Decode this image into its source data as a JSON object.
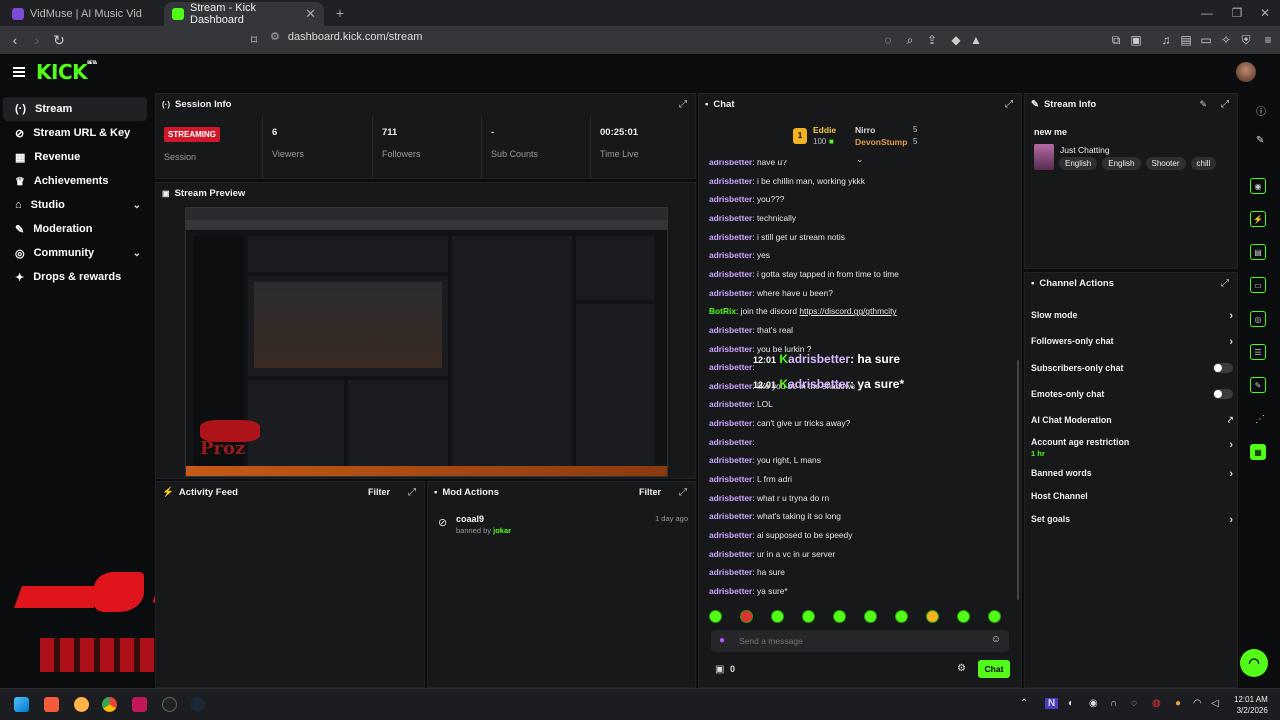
{
  "browser": {
    "tabs": [
      {
        "title": "VidMuse | AI Music Video Agent for",
        "active": false
      },
      {
        "title": "Stream - Kick Dashboard",
        "active": true
      }
    ],
    "url": "dashboard.kick.com/stream"
  },
  "site": {
    "logo": "KICK",
    "logo_badge": "BETA"
  },
  "sidebar": {
    "items": [
      {
        "label": "Stream",
        "icon": "broadcast-icon"
      },
      {
        "label": "Stream URL & Key",
        "icon": "link-icon"
      },
      {
        "label": "Revenue",
        "icon": "revenue-icon"
      },
      {
        "label": "Achievements",
        "icon": "trophy-icon"
      },
      {
        "label": "Studio",
        "icon": "studio-icon"
      },
      {
        "label": "Moderation",
        "icon": "wrench-icon"
      },
      {
        "label": "Community",
        "icon": "community-icon"
      },
      {
        "label": "Drops & rewards",
        "icon": "gift-icon"
      }
    ]
  },
  "session_info": {
    "title": "Session Info",
    "status_badge": "STREAMING",
    "session_label": "Session",
    "stats": [
      {
        "value": "6",
        "label": "Viewers"
      },
      {
        "value": "711",
        "label": "Followers"
      },
      {
        "value": "-",
        "label": "Sub Counts"
      },
      {
        "value": "00:25:01",
        "label": "Time Live"
      }
    ]
  },
  "stream_preview": {
    "title": "Stream Preview",
    "overlay_text": "Proz"
  },
  "activity_feed": {
    "title": "Activity Feed",
    "filter_label": "Filter"
  },
  "mod_actions": {
    "title": "Mod Actions",
    "filter_label": "Filter",
    "items": [
      {
        "user": "coaal9",
        "action_prefix": "banned by",
        "moderator": "jokar",
        "time": "1 day ago"
      }
    ]
  },
  "chat": {
    "title": "Chat",
    "leaderboard": [
      {
        "rank": "1",
        "name": "Eddie",
        "points": "100"
      },
      {
        "name": "Nirro",
        "points": "5"
      },
      {
        "name": "DevonStump",
        "points": "5"
      }
    ],
    "messages": [
      {
        "user": "adrisbetter",
        "text": "have u?"
      },
      {
        "user": "adrisbetter",
        "text": "i be chillin man, working ykkk"
      },
      {
        "user": "adrisbetter",
        "text": "you???"
      },
      {
        "user": "adrisbetter",
        "text": "technically"
      },
      {
        "user": "adrisbetter",
        "text": "i still get ur stream notis"
      },
      {
        "user": "adrisbetter",
        "text": "yes"
      },
      {
        "user": "adrisbetter",
        "text": "i gotta stay tapped in from time to time"
      },
      {
        "user": "adrisbetter",
        "text": "where have u been?"
      },
      {
        "user": "BotRix",
        "text": "join the discord",
        "link": "https://discord.gg/gthmcity"
      },
      {
        "user": "adrisbetter",
        "text": "that's real"
      },
      {
        "user": "adrisbetter",
        "text": "you be lurkin ?"
      },
      {
        "user": "adrisbetter",
        "text": ""
      },
      {
        "user": "adrisbetter",
        "text": "like you be in the shadows"
      },
      {
        "user": "adrisbetter",
        "text": "LOL"
      },
      {
        "user": "adrisbetter",
        "text": "can't give ur tricks away?"
      },
      {
        "user": "adrisbetter",
        "text": ""
      },
      {
        "user": "adrisbetter",
        "text": "you right, L mans"
      },
      {
        "user": "adrisbetter",
        "text": "L frm adri"
      },
      {
        "user": "adrisbetter",
        "text": "what r u tryna do rn"
      },
      {
        "user": "adrisbetter",
        "text": "what's taking it so long"
      },
      {
        "user": "adrisbetter",
        "text": "ai supposed to be speedy"
      },
      {
        "user": "adrisbetter",
        "text": "ur in a vc in ur server"
      },
      {
        "user": "adrisbetter",
        "text": "ha sure"
      },
      {
        "user": "adrisbetter",
        "text": "ya sure*"
      }
    ],
    "overlay_messages": [
      {
        "time": "12:01",
        "user": "adrisbetter",
        "text": "ha sure"
      },
      {
        "time": "12:01",
        "user": "adrisbetter",
        "text": "ya sure*"
      }
    ],
    "input_placeholder": "Send a message",
    "points": "0",
    "send_label": "Chat"
  },
  "stream_info": {
    "title": "Stream Info",
    "stream_title": "new me",
    "category": "Just Chatting",
    "tags": [
      "English",
      "English",
      "Shooter",
      "chill"
    ]
  },
  "channel_actions": {
    "title": "Channel Actions",
    "items": [
      {
        "label": "Slow mode",
        "control": "chevron"
      },
      {
        "label": "Followers-only chat",
        "control": "chevron"
      },
      {
        "label": "Subscribers-only chat",
        "control": "toggle"
      },
      {
        "label": "Emotes-only chat",
        "control": "toggle"
      },
      {
        "label": "AI Chat Moderation",
        "control": "external"
      },
      {
        "label": "Account age restriction",
        "sub": "1 hr",
        "control": "chevron"
      },
      {
        "label": "Banned words",
        "control": "chevron"
      },
      {
        "label": "Host Channel",
        "control": "none"
      },
      {
        "label": "Set goals",
        "control": "chevron"
      }
    ]
  },
  "taskbar": {
    "time": "12:01 AM",
    "date": "3/2/2026"
  },
  "colors": {
    "accent": "#53fc18",
    "badge_red": "#d0182a",
    "username": "#c9a5ff",
    "panel": "#17181a"
  }
}
